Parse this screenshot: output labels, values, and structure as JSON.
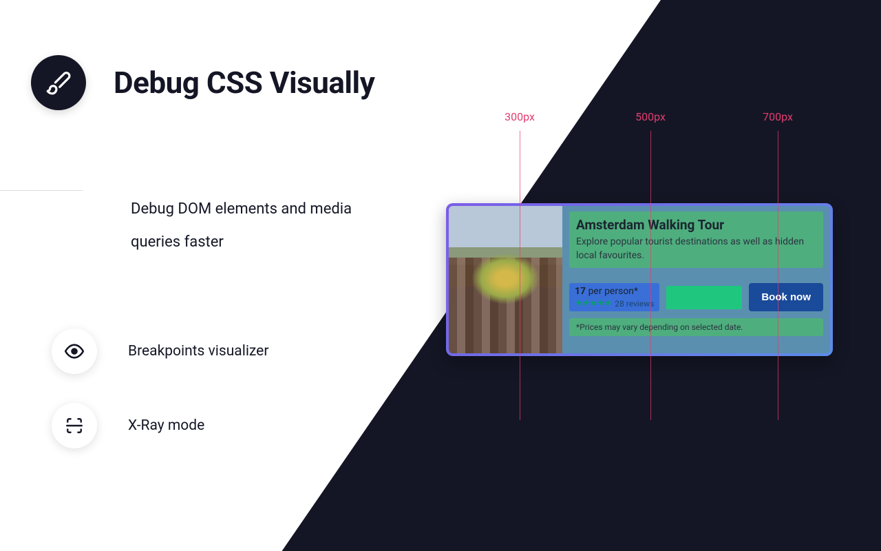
{
  "header": {
    "title": "Debug CSS Visually",
    "subtitle": "Debug DOM elements and media queries faster"
  },
  "features": [
    {
      "label": "Breakpoints visualizer"
    },
    {
      "label": "X-Ray mode"
    }
  ],
  "breakpoints": [
    {
      "label": "300px",
      "offset": 110
    },
    {
      "label": "500px",
      "offset": 300
    },
    {
      "label": "700px",
      "offset": 485
    }
  ],
  "card": {
    "title": "Amsterdam Walking Tour",
    "description": "Explore popular tourist destinations as well as hidden local favourites.",
    "price_value": "17",
    "price_unit": "per person*",
    "reviews": "28 reviews",
    "book_label": "Book now",
    "disclaimer": "*Prices may vary depending on selected date."
  }
}
